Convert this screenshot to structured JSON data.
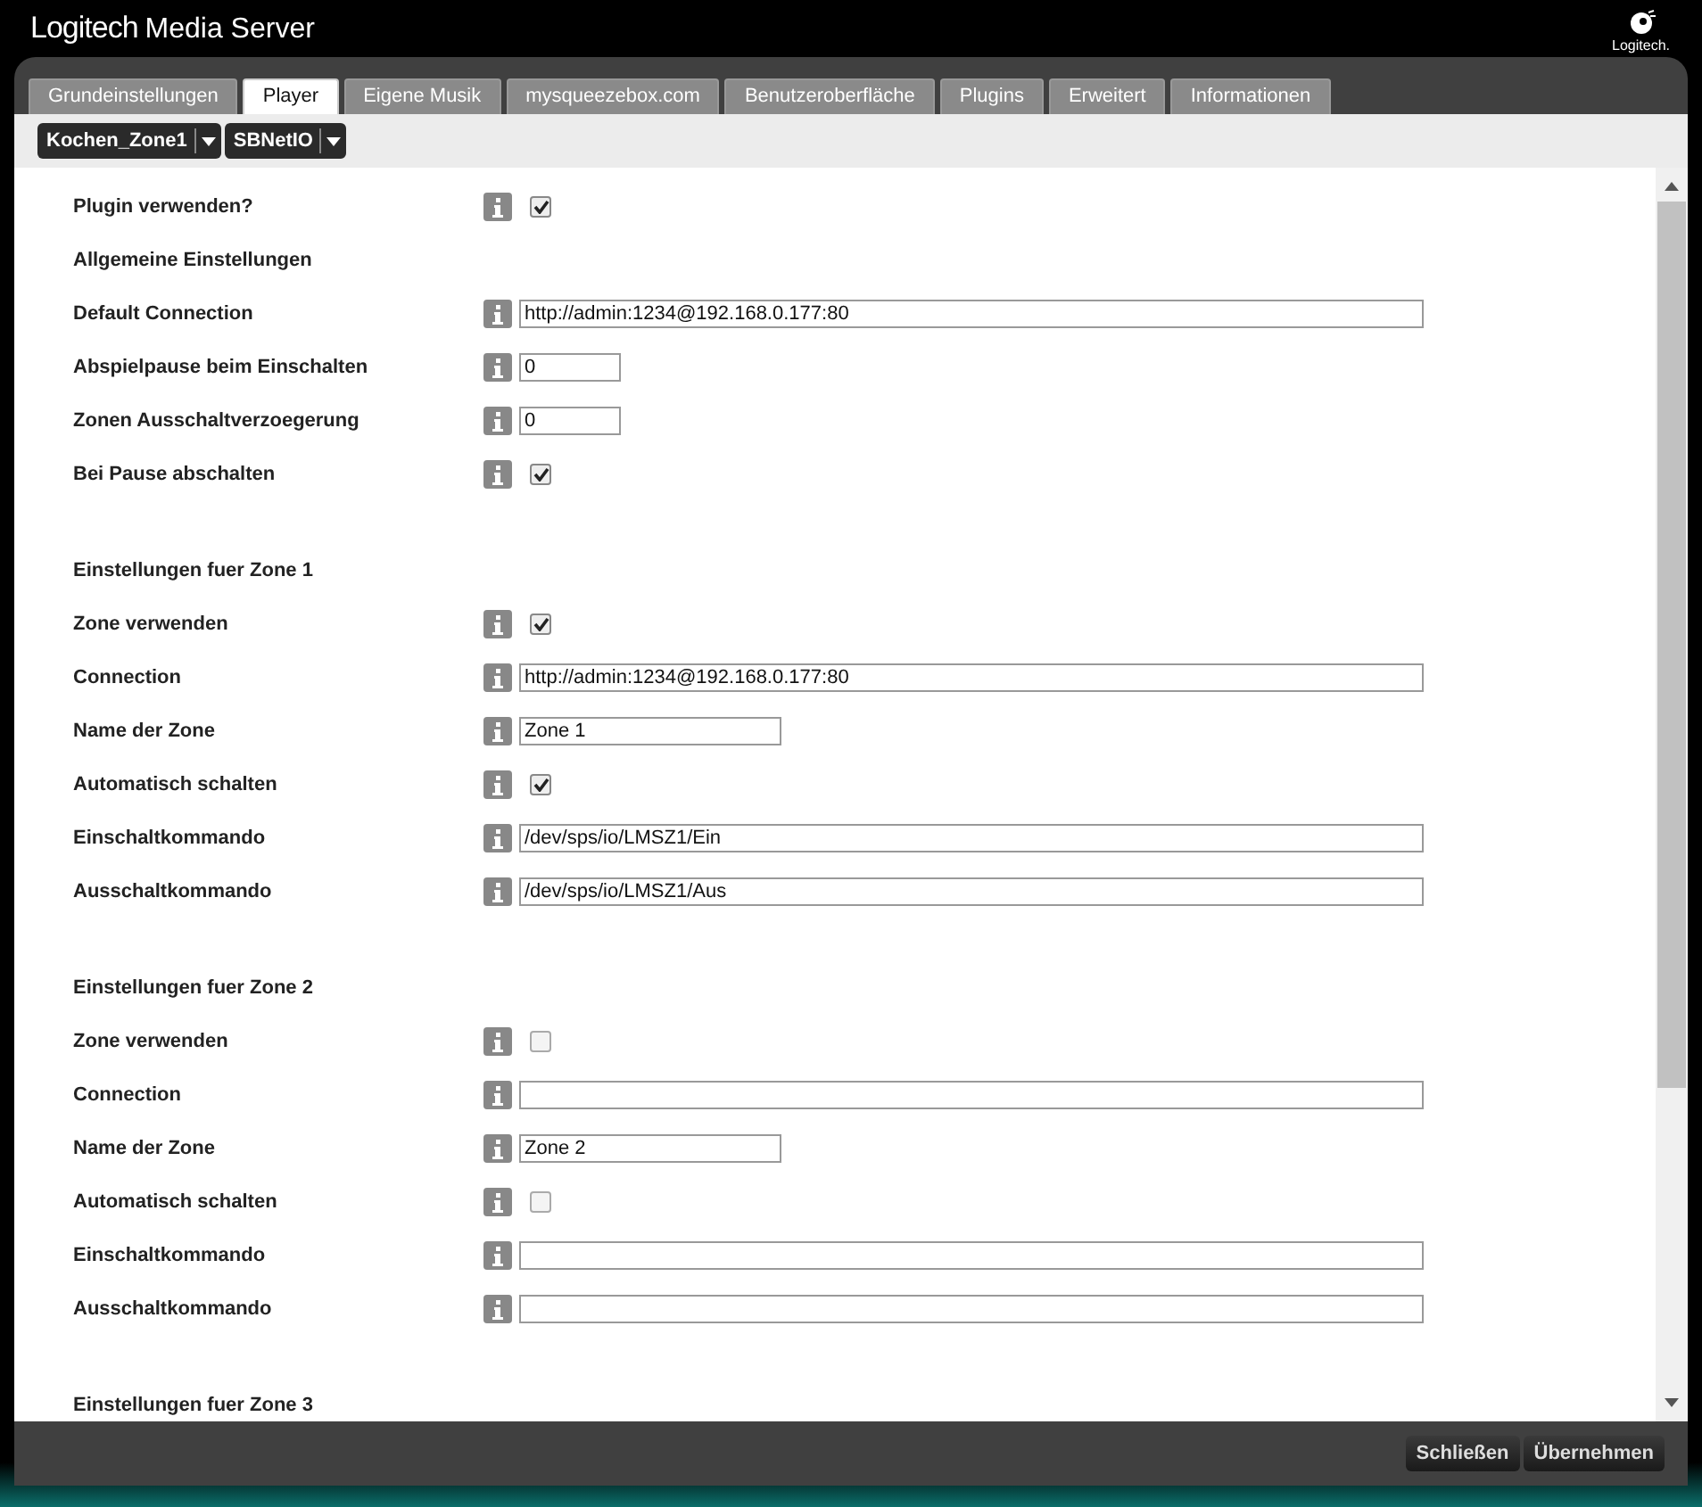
{
  "header": {
    "title_brand": "Logitech",
    "title_rest": "Media Server",
    "logo_text": "Logitech."
  },
  "tabs": [
    {
      "label": "Grundeinstellungen",
      "selected": false
    },
    {
      "label": "Player",
      "selected": true
    },
    {
      "label": "Eigene Musik",
      "selected": false
    },
    {
      "label": "mysqueezebox.com",
      "selected": false
    },
    {
      "label": "Benutzeroberfläche",
      "selected": false
    },
    {
      "label": "Plugins",
      "selected": false
    },
    {
      "label": "Erweitert",
      "selected": false
    },
    {
      "label": "Informationen",
      "selected": false
    }
  ],
  "selectors": [
    "Kochen_Zone1",
    "SBNetIO"
  ],
  "sections": [
    {
      "rows": [
        {
          "kind": "checkbox",
          "label": "Plugin verwenden?",
          "checked": true
        },
        {
          "kind": "heading",
          "label": "Allgemeine Einstellungen"
        },
        {
          "kind": "url",
          "label": "Default Connection",
          "value": "http://admin:1234@192.168.0.177:80"
        },
        {
          "kind": "number",
          "label": "Abspielpause beim Einschalten",
          "value": "0"
        },
        {
          "kind": "number",
          "label": "Zonen Ausschaltverzoegerung",
          "value": "0"
        },
        {
          "kind": "checkbox",
          "label": "Bei Pause abschalten",
          "checked": true
        }
      ]
    },
    {
      "rows": [
        {
          "kind": "heading",
          "label": "Einstellungen fuer Zone 1"
        },
        {
          "kind": "checkbox",
          "label": "Zone verwenden",
          "checked": true
        },
        {
          "kind": "url",
          "label": "Connection",
          "value": "http://admin:1234@192.168.0.177:80"
        },
        {
          "kind": "name",
          "label": "Name der Zone",
          "value": "Zone 1"
        },
        {
          "kind": "checkbox",
          "label": "Automatisch schalten",
          "checked": true
        },
        {
          "kind": "command",
          "label": "Einschaltkommando",
          "value": "/dev/sps/io/LMSZ1/Ein"
        },
        {
          "kind": "command",
          "label": "Ausschaltkommando",
          "value": "/dev/sps/io/LMSZ1/Aus"
        }
      ]
    },
    {
      "rows": [
        {
          "kind": "heading",
          "label": "Einstellungen fuer Zone 2"
        },
        {
          "kind": "checkbox",
          "label": "Zone verwenden",
          "checked": false
        },
        {
          "kind": "url",
          "label": "Connection"
        },
        {
          "kind": "name",
          "label": "Name der Zone",
          "value": "Zone 2"
        },
        {
          "kind": "checkbox",
          "label": "Automatisch schalten",
          "checked": false
        },
        {
          "kind": "command",
          "label": "Einschaltkommando"
        },
        {
          "kind": "command",
          "label": "Ausschaltkommando"
        }
      ]
    },
    {
      "rows": [
        {
          "kind": "heading",
          "label": "Einstellungen fuer Zone 3"
        }
      ]
    }
  ],
  "buttons": [
    "Schließen",
    "Übernehmen"
  ]
}
